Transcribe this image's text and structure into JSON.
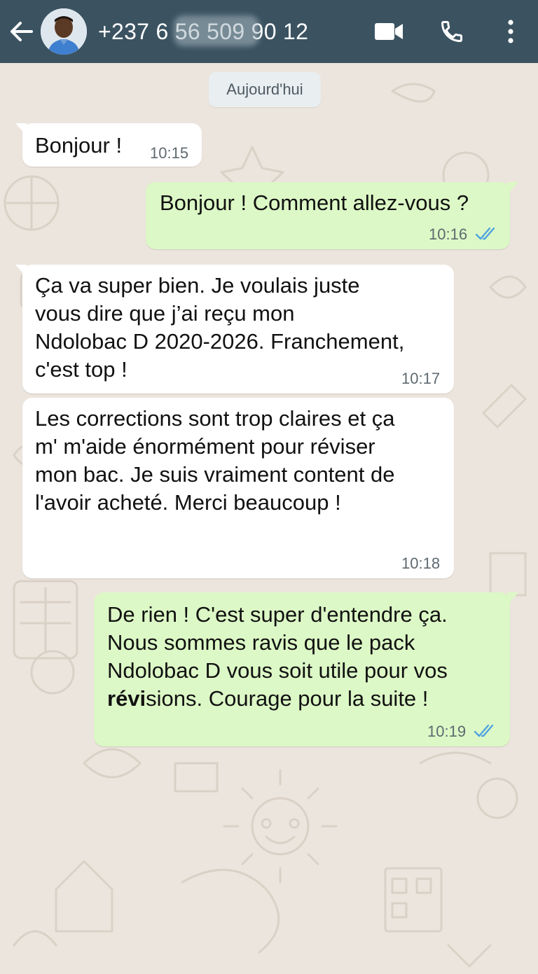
{
  "header": {
    "contact_number": "+237 6 56 509 90 12",
    "icons": [
      "back-arrow-icon",
      "avatar",
      "video-call-icon",
      "phone-icon",
      "more-vert-icon"
    ],
    "colors": {
      "bar": "#3b5361"
    }
  },
  "date_pill": "Aujourd'hui",
  "messages": [
    {
      "direction": "in",
      "text": "Bonjour !",
      "time": "10:15"
    },
    {
      "direction": "out",
      "text": "Bonjour ! Comment allez-vous ?",
      "time": "10:16",
      "ticks": "read-double-check-icon"
    },
    {
      "direction": "in",
      "lines": [
        "Ça va super bien. Je voulais juste",
        "vous dire que j’ai reçu mon",
        "Ndolobac D 2020-2026. Franchement,",
        "c'est top !"
      ],
      "time": "10:17"
    },
    {
      "direction": "in",
      "lines": [
        "Les corrections sont trop claires et ça",
        "m' m'aide énormément pour réviser",
        "mon bac. Je suis vraiment content de",
        "l'avoir acheté. Merci beaucoup !"
      ],
      "time": "10:18"
    },
    {
      "direction": "out",
      "lines": [
        "De rien ! C'est super d'entendre ça.",
        "Nous sommes ravis que le pack",
        "Ndolobac D vous soit utile pour vos"
      ],
      "last_line_bold": "révi",
      "last_line_rest": "sions. Courage pour la suite !",
      "time": "10:19",
      "ticks": "read-double-check-icon"
    }
  ],
  "colors": {
    "incoming": "#ffffff",
    "outgoing": "#dcf8c6",
    "wallpaper": "#ece5dd",
    "read_ticks": "#4fa3e0"
  }
}
